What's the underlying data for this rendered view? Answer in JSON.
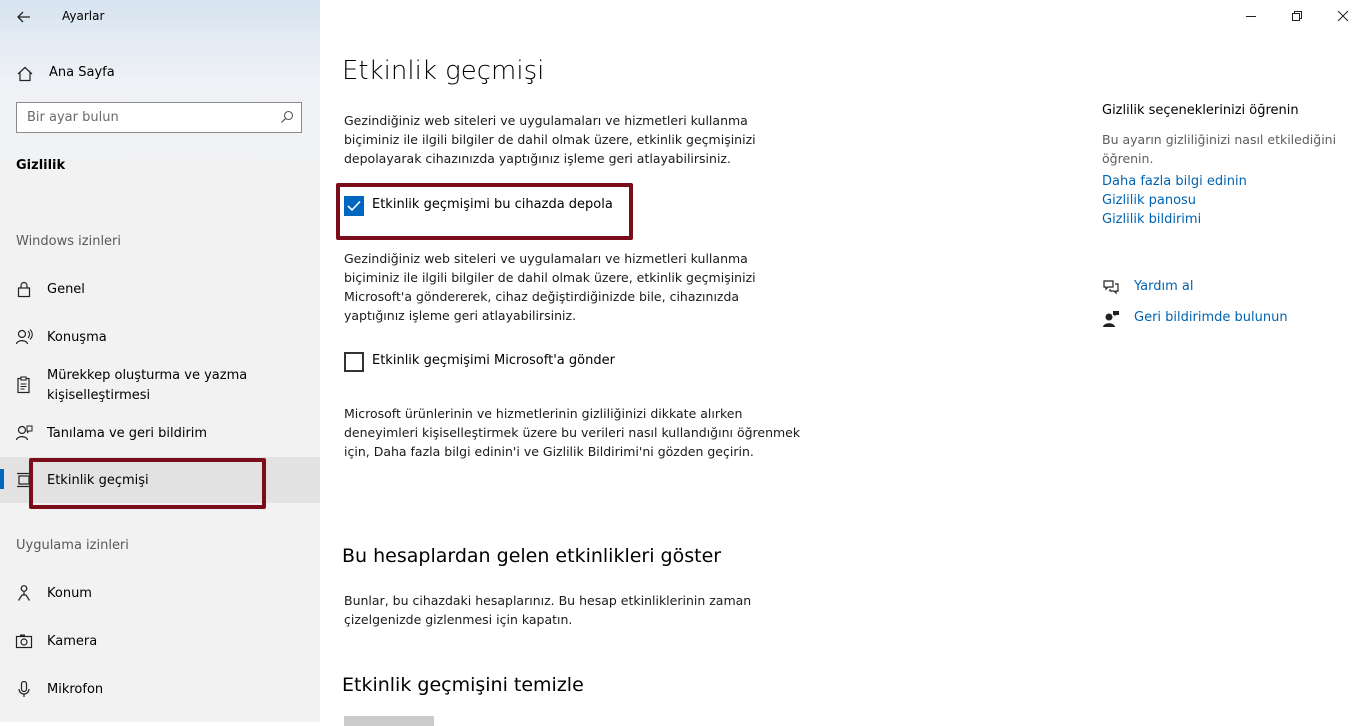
{
  "window": {
    "title": "Ayarlar",
    "controls": [
      "minimize",
      "restore",
      "close"
    ]
  },
  "sidebar": {
    "home_label": "Ana Sayfa",
    "search_placeholder": "Bir ayar bulun",
    "section_title": "Gizlilik",
    "windows_group_label": "Windows izinleri",
    "windows_items": [
      {
        "label": "Genel",
        "icon": "lock-icon"
      },
      {
        "label": "Konuşma",
        "icon": "speech-icon"
      },
      {
        "label": "Mürekkep oluşturma ve yazma kişiselleştirmesi",
        "icon": "inking-icon"
      },
      {
        "label": "Tanılama ve geri bildirim",
        "icon": "feedback-icon"
      },
      {
        "label": "Etkinlik geçmişi",
        "icon": "timeline-icon",
        "selected": true
      }
    ],
    "app_group_label": "Uygulama izinleri",
    "app_items": [
      {
        "label": "Konum",
        "icon": "location-icon"
      },
      {
        "label": "Kamera",
        "icon": "camera-icon"
      },
      {
        "label": "Mikrofon",
        "icon": "microphone-icon"
      }
    ]
  },
  "main": {
    "title": "Etkinlik geçmişi",
    "intro": "Gezindiğiniz web siteleri ve uygulamaları ve hizmetleri kullanma biçiminiz ile ilgili bilgiler de dahil olmak üzere, etkinlik geçmişinizi depolayarak cihazınızda yaptığınız işleme geri atlayabilirsiniz.",
    "store_checkbox": {
      "label": "Etkinlik geçmişimi bu cihazda depola",
      "checked": true
    },
    "send_description": "Gezindiğiniz web siteleri ve uygulamaları ve hizmetleri kullanma biçiminiz ile ilgili bilgiler de dahil olmak üzere, etkinlik geçmişinizi Microsoft'a göndererek, cihaz değiştirdiğinizde bile, cihazınızda yaptığınız işleme geri atlayabilirsiniz.",
    "send_checkbox": {
      "label": "Etkinlik geçmişimi Microsoft'a gönder",
      "checked": false
    },
    "privacy_note": "Microsoft ürünlerinin ve hizmetlerinin gizliliğinizi dikkate alırken deneyimleri kişiselleştirmek üzere bu verileri nasıl kullandığını öğrenmek için, Daha fazla bilgi edinin'i ve Gizlilik Bildirimi'ni gözden geçirin.",
    "accounts_heading": "Bu hesaplardan gelen etkinlikleri göster",
    "accounts_text": "Bunlar, bu cihazdaki hesaplarınız. Bu hesap etkinliklerinin zaman çizelgenizde gizlenmesi için kapatın.",
    "clear_heading": "Etkinlik geçmişini temizle"
  },
  "right_panel": {
    "title": "Gizlilik seçeneklerinizi öğrenin",
    "description": "Bu ayarın gizliliğinizi nasıl etkilediğini öğrenin.",
    "links": [
      "Daha fazla bilgi edinin",
      "Gizlilik panosu",
      "Gizlilik bildirimi"
    ],
    "help_label": "Yardım al",
    "feedback_label": "Geri bildirimde bulunun"
  },
  "colors": {
    "accent": "#0067c0",
    "link": "#0063b1",
    "annotation_box": "#7b0c1a",
    "sidebar_bg": "#f2f2f2"
  }
}
